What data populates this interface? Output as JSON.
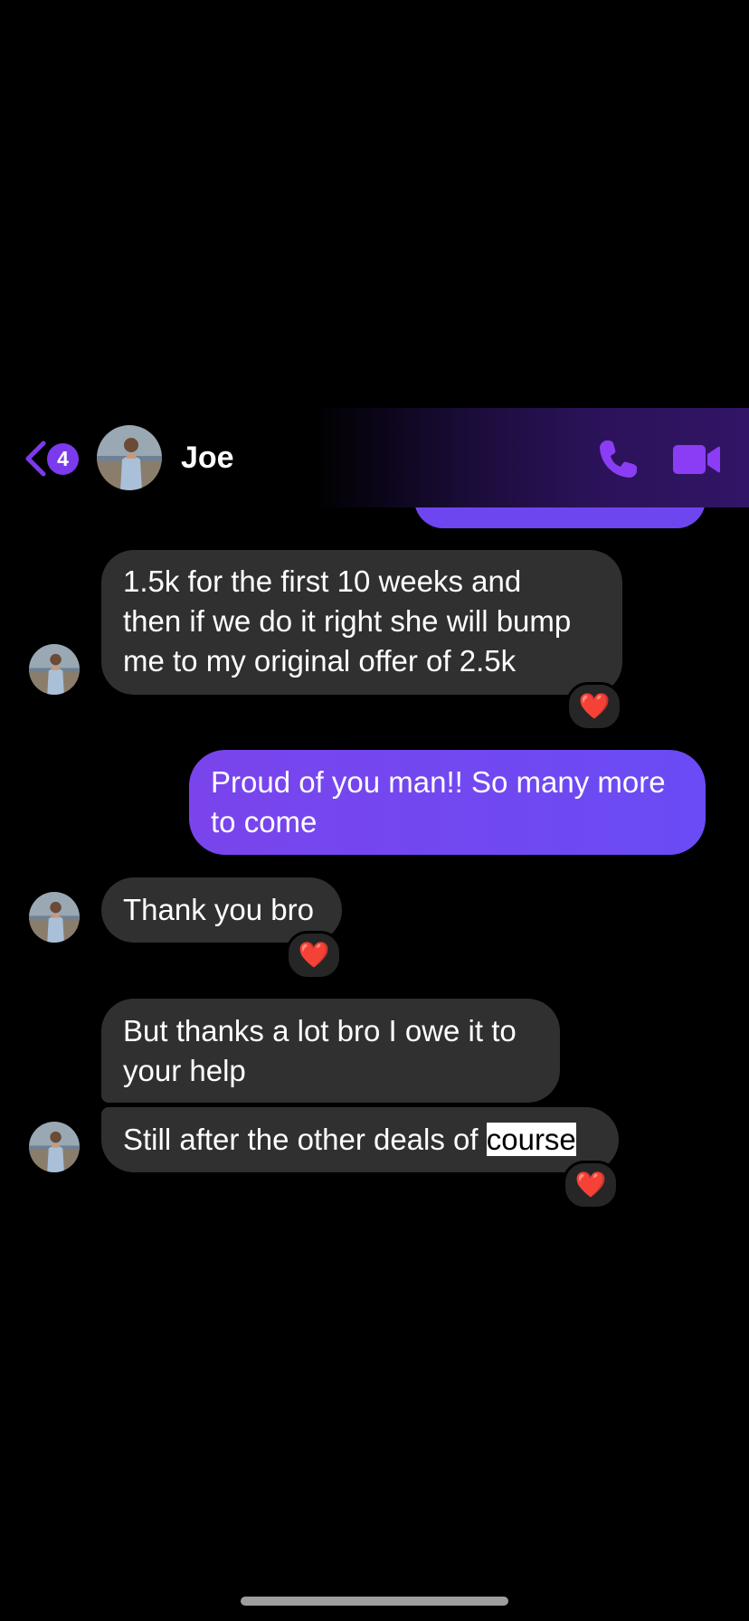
{
  "header": {
    "unread_count": "4",
    "contact_name": "Joe"
  },
  "colors": {
    "accent": "#7c3aed",
    "sent_bubble": "#6d46f0",
    "received_bubble": "#303030",
    "background": "#000000"
  },
  "messages": [
    {
      "sender": "contact",
      "lines": [
        "1.5k  for the first 10 weeks and",
        "then if we do it right she will bump",
        "me to my original offer of 2.5k"
      ],
      "reaction": "❤️"
    },
    {
      "sender": "me",
      "lines": [
        "Proud of you man!! So many more",
        "to come"
      ]
    },
    {
      "sender": "contact",
      "lines": [
        "Thank you bro"
      ],
      "reaction": "❤️"
    },
    {
      "sender": "contact",
      "lines": [
        "But thanks a lot bro I owe it to",
        "your help"
      ]
    },
    {
      "sender": "contact",
      "text_before_selection": "Still after the other deals of ",
      "selected_text": "course",
      "reaction": "❤️"
    }
  ],
  "icons": {
    "back": "chevron-left-icon",
    "call": "phone-icon",
    "video": "video-camera-icon"
  }
}
